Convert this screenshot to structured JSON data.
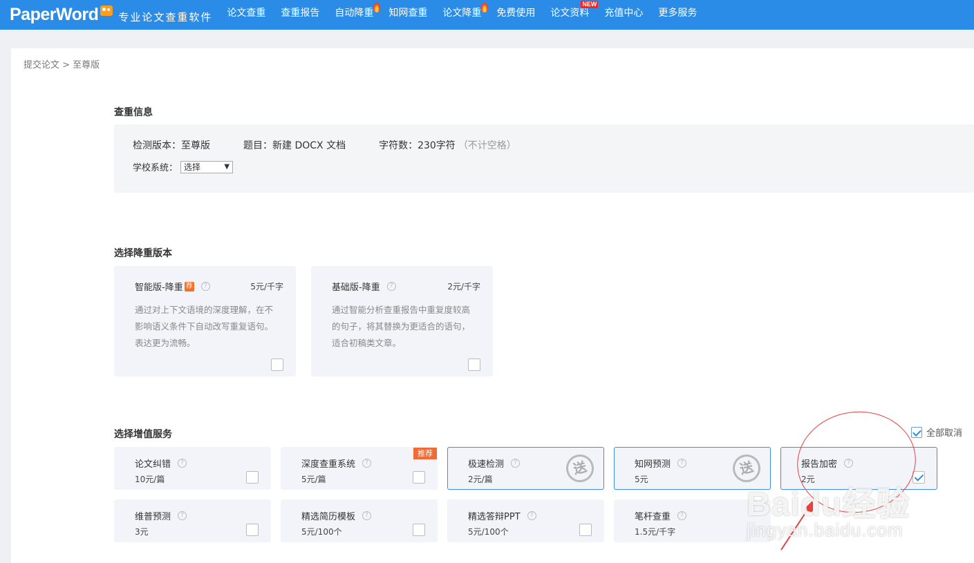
{
  "header": {
    "logo": "PaperWord",
    "slogan": "专业论文查重软件",
    "nav": [
      {
        "label": "论文查重",
        "hot": false,
        "new": false
      },
      {
        "label": "查重报告",
        "hot": false,
        "new": false
      },
      {
        "label": "自动降重",
        "hot": true,
        "new": false
      },
      {
        "label": "知网查重",
        "hot": false,
        "new": false
      },
      {
        "label": "论文降重",
        "hot": true,
        "new": false
      },
      {
        "label": "免费使用",
        "hot": false,
        "new": false
      },
      {
        "label": "论文资料",
        "hot": false,
        "new": true
      },
      {
        "label": "充值中心",
        "hot": false,
        "new": false
      },
      {
        "label": "更多服务",
        "hot": false,
        "new": false
      }
    ],
    "new_badge": "NEW"
  },
  "breadcrumb": "提交论文 > 至尊版",
  "check_info": {
    "title": "查重信息",
    "version": "检测版本：至尊版",
    "topic": "题目：新建 DOCX 文档",
    "chars": "字符数：230字符",
    "chars_hint": "（不计空格）",
    "school_label": "学校系统：",
    "school_value": "选择"
  },
  "reduce": {
    "title": "选择降重版本",
    "cards": [
      {
        "name": "智能版-降重",
        "tag": "荐",
        "price": "5元/千字",
        "desc": "通过对上下文语境的深度理解，在不影响语义条件下自动改写重复语句。表达更为流畅。"
      },
      {
        "name": "基础版-降重",
        "tag": "",
        "price": "2元/千字",
        "desc": "通过智能分析查重报告中重复度较高的句子，将其替换为更适合的语句，适合初稿类文章。"
      }
    ]
  },
  "addons": {
    "title": "选择增值服务",
    "cancel_all": "全部取消",
    "rec_label": "推荐",
    "gift_label": "送",
    "items": [
      {
        "name": "论文纠错",
        "price": "10元/篇"
      },
      {
        "name": "深度查重系统",
        "price": "5元/篇"
      },
      {
        "name": "极速检测",
        "price": "2元/篇"
      },
      {
        "name": "知网预测",
        "price": "5元"
      },
      {
        "name": "报告加密",
        "price": "2元"
      },
      {
        "name": "维普预测",
        "price": "3元"
      },
      {
        "name": "精选简历模板",
        "price": "5元/100个"
      },
      {
        "name": "精选答辩PPT",
        "price": "5元/100个"
      },
      {
        "name": "笔杆查重",
        "price": "1.5元/千字"
      }
    ]
  },
  "watermark": {
    "main": "Baidu经验",
    "sub": "jingyan.baidu.com"
  },
  "colors": {
    "primary": "#2b8ce8",
    "accent": "#f06a35",
    "annotation": "#e84040"
  }
}
